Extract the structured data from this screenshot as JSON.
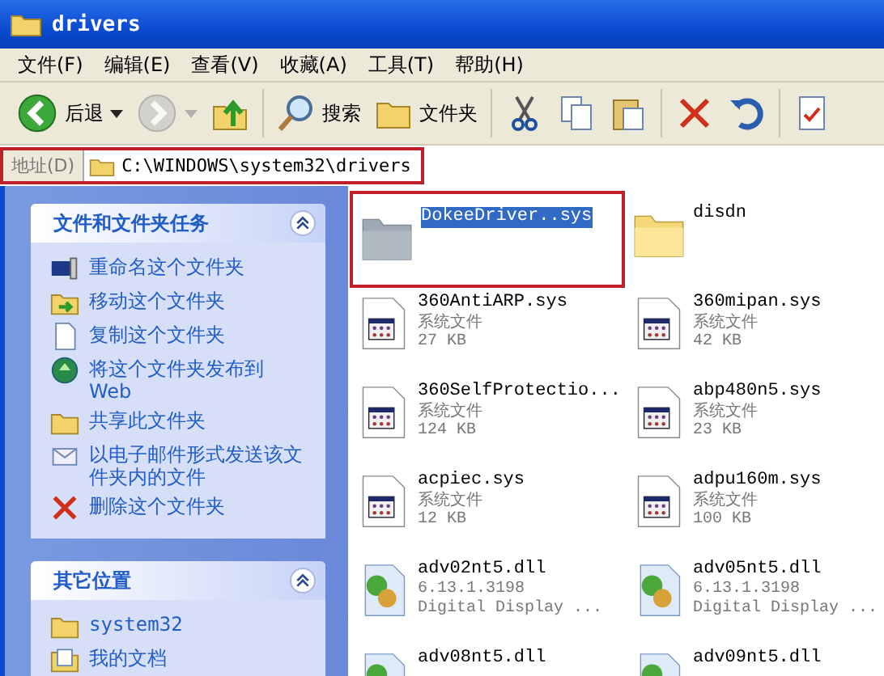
{
  "window": {
    "title": "drivers"
  },
  "menu": [
    "文件(F)",
    "编辑(E)",
    "查看(V)",
    "收藏(A)",
    "工具(T)",
    "帮助(H)"
  ],
  "toolbar": [
    {
      "kind": "back",
      "label": "后退",
      "disabled": false,
      "dropdown": true
    },
    {
      "kind": "forward",
      "disabled": true,
      "dropdown": true
    },
    {
      "kind": "up",
      "disabled": false
    },
    {
      "kind": "search",
      "label": "搜索",
      "disabled": false
    },
    {
      "kind": "folders",
      "label": "文件夹",
      "disabled": false
    },
    {
      "kind": "cut",
      "disabled": false
    },
    {
      "kind": "copy",
      "disabled": false
    },
    {
      "kind": "paste",
      "disabled": false
    },
    {
      "kind": "delete",
      "disabled": false
    },
    {
      "kind": "undo",
      "disabled": false
    },
    {
      "kind": "views",
      "disabled": false
    }
  ],
  "address": {
    "label": "地址(D)",
    "value": "C:\\WINDOWS\\system32\\drivers",
    "highlighted": true
  },
  "sidebar": [
    {
      "title": "文件和文件夹任务",
      "expanded": true,
      "items": [
        {
          "kind": "rename",
          "label": "重命名这个文件夹"
        },
        {
          "kind": "move",
          "label": "移动这个文件夹"
        },
        {
          "kind": "copy",
          "label": "复制这个文件夹"
        },
        {
          "kind": "publish",
          "label": "将这个文件夹发布到 Web"
        },
        {
          "kind": "share",
          "label": "共享此文件夹"
        },
        {
          "kind": "email",
          "label": "以电子邮件形式发送该文件夹内的文件"
        },
        {
          "kind": "delete",
          "label": "删除这个文件夹"
        }
      ]
    },
    {
      "title": "其它位置",
      "expanded": true,
      "items": [
        {
          "kind": "folder",
          "label": "system32"
        },
        {
          "kind": "docs",
          "label": "我的文档"
        }
      ]
    }
  ],
  "files": [
    {
      "kind": "folder",
      "name": "DokeeDriver..sys",
      "selected": true,
      "ghosted": true,
      "highlighted": true
    },
    {
      "kind": "folder",
      "name": "disdn",
      "selected": false,
      "ghosted": false
    },
    {
      "kind": "sys",
      "name": "360AntiARP.sys",
      "lines": [
        "系统文件",
        "27 KB"
      ],
      "selected": false
    },
    {
      "kind": "sys",
      "name": "360mipan.sys",
      "lines": [
        "系统文件",
        "42 KB"
      ],
      "selected": false
    },
    {
      "kind": "sys",
      "name": "360SelfProtectio...",
      "lines": [
        "系统文件",
        "124 KB"
      ],
      "selected": false
    },
    {
      "kind": "sys",
      "name": "abp480n5.sys",
      "lines": [
        "系统文件",
        "23 KB"
      ],
      "selected": false
    },
    {
      "kind": "sys",
      "name": "acpiec.sys",
      "lines": [
        "系统文件",
        "12 KB"
      ],
      "selected": false
    },
    {
      "kind": "sys",
      "name": "adpu160m.sys",
      "lines": [
        "系统文件",
        "100 KB"
      ],
      "selected": false
    },
    {
      "kind": "dll",
      "name": "adv02nt5.dll",
      "lines": [
        "6.13.1.3198",
        "Digital Display ..."
      ],
      "selected": false
    },
    {
      "kind": "dll",
      "name": "adv05nt5.dll",
      "lines": [
        "6.13.1.3198",
        "Digital Display ..."
      ],
      "selected": false
    },
    {
      "kind": "dll",
      "name": "adv08nt5.dll",
      "selected": false
    },
    {
      "kind": "dll",
      "name": "adv09nt5.dll",
      "selected": false
    }
  ]
}
